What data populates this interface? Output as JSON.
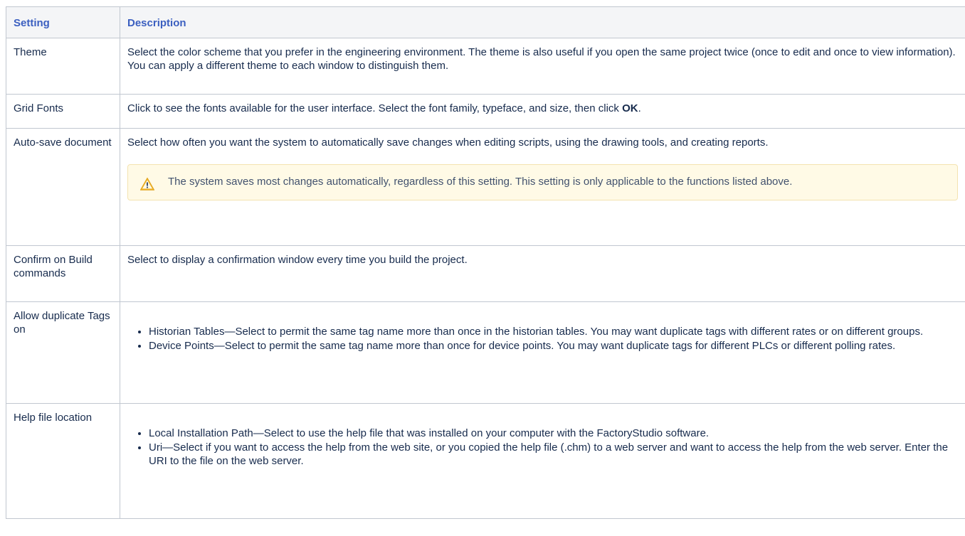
{
  "header": {
    "setting": "Setting",
    "description": "Description"
  },
  "rows": {
    "theme": {
      "setting": "Theme",
      "description": "Select the color scheme that you prefer in the engineering environment. The theme is also useful if you open the same project twice (once to edit and once to view information). You can apply a different theme to each window to distinguish them."
    },
    "grid_fonts": {
      "setting": "Grid Fonts",
      "description_before": "Click to see the fonts available for the user interface. Select the font family, typeface, and size, then click ",
      "description_bold": "OK",
      "description_after": "."
    },
    "auto_save": {
      "setting": "Auto-save document",
      "description": "Select how often you want the system to automatically save changes when editing scripts, using the drawing tools, and creating reports.",
      "warning": {
        "icon": "warning-icon",
        "text": "The system saves most changes automatically, regardless of this setting. This setting is only applicable to the functions listed above."
      }
    },
    "confirm_build": {
      "setting": "Confirm on Build commands",
      "description": "Select to display a confirmation window every time you build the project."
    },
    "allow_duplicate": {
      "setting": "Allow duplicate Tags on",
      "bullets": [
        "Historian Tables—Select to permit the same tag name more than once in the historian tables. You may want duplicate tags with different rates or on different groups.",
        "Device Points—Select to permit the same tag name more than once for device points. You may want duplicate tags for different PLCs or different polling rates."
      ]
    },
    "help_file": {
      "setting": "Help file location",
      "bullets": [
        "Local Installation Path—Select to use the help file that was installed on your computer with the FactoryStudio software.",
        "Uri—Select if you want to access the help from the web site, or you copied the help file (.chm) to a web server and want to access the help from the web server. Enter the URI to the file on the web server."
      ]
    }
  },
  "colors": {
    "header_text": "#3b5fc0",
    "header_bg": "#f4f5f7",
    "border": "#c1c7d0",
    "warning_bg": "#fffae6",
    "warning_icon": "#f0b429"
  }
}
